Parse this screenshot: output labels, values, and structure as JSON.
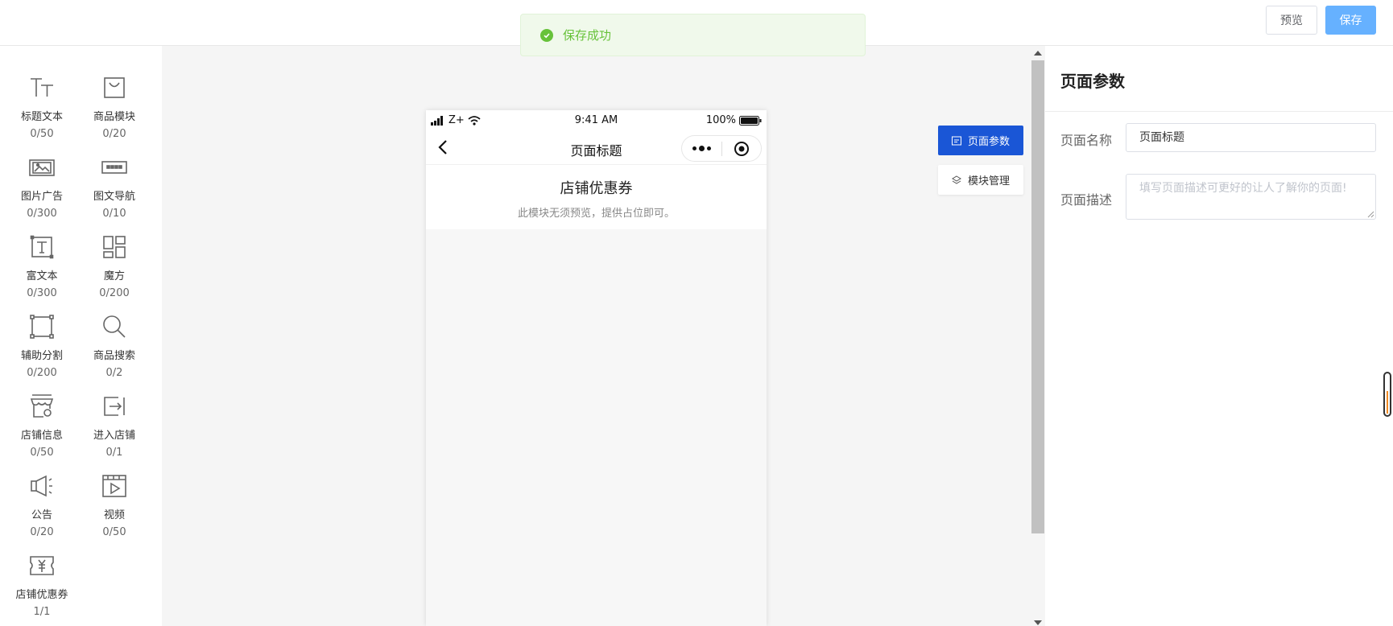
{
  "toolbar": {
    "preview_label": "预览",
    "save_label": "保存"
  },
  "toast": {
    "message": "保存成功"
  },
  "widgets": [
    {
      "label": "标题文本",
      "count": "0/50",
      "icon": "title-text-icon"
    },
    {
      "label": "商品模块",
      "count": "0/20",
      "icon": "shopping-bag-icon"
    },
    {
      "label": "图片广告",
      "count": "0/300",
      "icon": "image-ad-icon"
    },
    {
      "label": "图文导航",
      "count": "0/10",
      "icon": "image-nav-icon"
    },
    {
      "label": "富文本",
      "count": "0/300",
      "icon": "rich-text-icon"
    },
    {
      "label": "魔方",
      "count": "0/200",
      "icon": "cube-layout-icon"
    },
    {
      "label": "辅助分割",
      "count": "0/200",
      "icon": "divider-box-icon"
    },
    {
      "label": "商品搜索",
      "count": "0/2",
      "icon": "search-icon"
    },
    {
      "label": "店铺信息",
      "count": "0/50",
      "icon": "store-info-icon"
    },
    {
      "label": "进入店铺",
      "count": "0/1",
      "icon": "enter-store-icon"
    },
    {
      "label": "公告",
      "count": "0/20",
      "icon": "megaphone-icon"
    },
    {
      "label": "视频",
      "count": "0/50",
      "icon": "video-icon"
    },
    {
      "label": "店铺优惠券",
      "count": "1/1",
      "icon": "coupon-icon"
    }
  ],
  "phone": {
    "carrier": "Z+",
    "time": "9:41 AM",
    "battery": "100%",
    "nav_title": "页面标题",
    "coupon_title": "店铺优惠券",
    "coupon_subtitle": "此模块无须预览，提供占位即可。"
  },
  "side_tabs": {
    "params": "页面参数",
    "modules": "模块管理"
  },
  "right_panel": {
    "title": "页面参数",
    "name_label": "页面名称",
    "name_value": "页面标题",
    "desc_label": "页面描述",
    "desc_placeholder": "填写页面描述可更好的让人了解你的页面!"
  },
  "colors": {
    "primary": "#1a56d6",
    "save_button": "#66b1ff",
    "success": "#67c23a"
  }
}
